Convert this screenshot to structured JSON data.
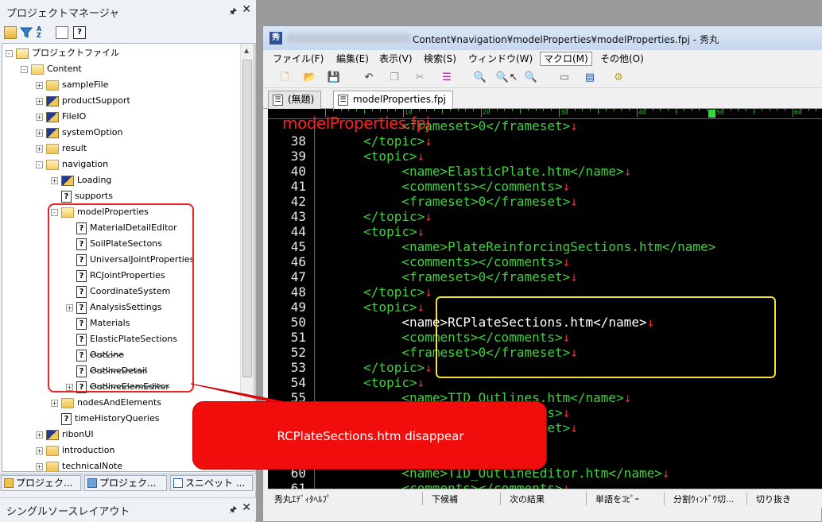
{
  "project_manager": {
    "title": "プロジェクトマネージャ",
    "pin": "ᵖ",
    "close": "✕",
    "toolbar_icons": [
      "folder-open-icon",
      "filter-icon",
      "sort-az-icon",
      "document-icon",
      "help-icon"
    ],
    "tree": [
      {
        "label": "プロジェクトファイル",
        "icon": "project",
        "level": 0,
        "expander": "-"
      },
      {
        "label": "Content",
        "icon": "folder-open",
        "level": 1,
        "expander": "-"
      },
      {
        "label": "sampleFile",
        "icon": "folder",
        "level": 2,
        "expander": "+"
      },
      {
        "label": "productSupport",
        "icon": "folder-mixed",
        "level": 2,
        "expander": "+"
      },
      {
        "label": "FileIO",
        "icon": "folder-mixed",
        "level": 2,
        "expander": "+"
      },
      {
        "label": "systemOption",
        "icon": "folder-mixed",
        "level": 2,
        "expander": "+"
      },
      {
        "label": "result",
        "icon": "folder",
        "level": 2,
        "expander": "+"
      },
      {
        "label": "navigation",
        "icon": "folder-open",
        "level": 2,
        "expander": "-"
      },
      {
        "label": "Loading",
        "icon": "folder-mixed",
        "level": 3,
        "expander": "+"
      },
      {
        "label": "supports",
        "icon": "help",
        "level": 3,
        "expander": ""
      },
      {
        "label": "modelProperties",
        "icon": "folder-open",
        "level": 3,
        "expander": "-"
      },
      {
        "label": "MaterialDetailEditor",
        "icon": "help",
        "level": 4,
        "expander": ""
      },
      {
        "label": "SoilPlateSectons",
        "icon": "help",
        "level": 4,
        "expander": ""
      },
      {
        "label": "UniversalJointProperties",
        "icon": "help",
        "level": 4,
        "expander": ""
      },
      {
        "label": "RCJointProperties",
        "icon": "help",
        "level": 4,
        "expander": ""
      },
      {
        "label": "CoordinateSystem",
        "icon": "help",
        "level": 4,
        "expander": ""
      },
      {
        "label": "AnalysisSettings",
        "icon": "help",
        "level": 4,
        "expander": "+"
      },
      {
        "label": "Materials",
        "icon": "help",
        "level": 4,
        "expander": ""
      },
      {
        "label": "ElasticPlateSections",
        "icon": "help",
        "level": 4,
        "expander": ""
      },
      {
        "label": "OutLine",
        "icon": "help",
        "level": 4,
        "expander": "",
        "struck": true
      },
      {
        "label": "OutlineDetail",
        "icon": "help",
        "level": 4,
        "expander": "",
        "struck": true
      },
      {
        "label": "OutlineElemEditor",
        "icon": "help",
        "level": 4,
        "expander": "+",
        "struck": true
      },
      {
        "label": "nodesAndElements",
        "icon": "folder",
        "level": 3,
        "expander": "+"
      },
      {
        "label": "timeHistoryQueries",
        "icon": "help",
        "level": 3,
        "expander": ""
      },
      {
        "label": "ribonUI",
        "icon": "folder-mixed",
        "level": 2,
        "expander": "+"
      },
      {
        "label": "introduction",
        "icon": "folder",
        "level": 2,
        "expander": "+"
      },
      {
        "label": "technicalNote",
        "icon": "folder",
        "level": 2,
        "expander": "+"
      }
    ],
    "bottom_tabs": [
      "プロジェク...",
      "プロジェク...",
      "スニペット ..."
    ],
    "single_source_layout_title": "シングルソースレイアウト"
  },
  "editor": {
    "title": "Content¥navigation¥modelProperties¥modelProperties.fpj  - 秀丸",
    "menu": [
      "ファイル(F)",
      "編集(E)",
      "表示(V)",
      "検索(S)",
      "ウィンドウ(W)",
      "マクロ(M)",
      "その他(O)"
    ],
    "active_menu": "マクロ(M)",
    "tabs": [
      "(無題)",
      "modelProperties.fpj"
    ],
    "overlay_title": "modelProperties.fpj",
    "ruler_labels": [
      "10",
      "20",
      "30",
      "40",
      "50",
      "60"
    ],
    "code_lines": [
      {
        "n": "",
        "text": "          <frameset>0</frameset>",
        "eol": "↓"
      },
      {
        "n": "38",
        "text": "     </topic>",
        "eol": "↓"
      },
      {
        "n": "39",
        "text": "     <topic>",
        "eol": "↓"
      },
      {
        "n": "40",
        "text": "          <name>ElasticPlate.htm</name>",
        "eol": "↓"
      },
      {
        "n": "41",
        "text": "          <comments></comments>",
        "eol": "↓"
      },
      {
        "n": "42",
        "text": "          <frameset>0</frameset>",
        "eol": "↓"
      },
      {
        "n": "43",
        "text": "     </topic>",
        "eol": "↓"
      },
      {
        "n": "44",
        "text": "     <topic>",
        "eol": "↓"
      },
      {
        "n": "45",
        "text": "          <name>PlateReinforcingSections.htm</name>",
        "eol": ""
      },
      {
        "n": "46",
        "text": "          <comments></comments>",
        "eol": "↓"
      },
      {
        "n": "47",
        "text": "          <frameset>0</frameset>",
        "eol": "↓"
      },
      {
        "n": "48",
        "text": "     </topic>",
        "eol": "↓"
      },
      {
        "n": "49",
        "text": "     <topic>",
        "eol": "↓"
      },
      {
        "n": "50",
        "text": "          <name>RCPlateSections.htm</name>",
        "eol": "↓",
        "highlight": true
      },
      {
        "n": "51",
        "text": "          <comments></comments>",
        "eol": "↓"
      },
      {
        "n": "52",
        "text": "          <frameset>0</frameset>",
        "eol": "↓"
      },
      {
        "n": "53",
        "text": "     </topic>",
        "eol": "↓"
      },
      {
        "n": "54",
        "text": "     <topic>",
        "eol": "↓"
      },
      {
        "n": "55",
        "text": "          <name>TID_Outlines.htm</name>",
        "eol": "↓"
      },
      {
        "n": "56",
        "text": "          <comments></comments>",
        "eol": "↓"
      },
      {
        "n": "57",
        "text": "          <frameset>0</frameset>",
        "eol": "↓"
      },
      {
        "n": "58",
        "text": "     </topic>",
        "eol": "↓"
      },
      {
        "n": "59",
        "text": "     <topic>",
        "eol": "↓"
      },
      {
        "n": "60",
        "text": "          <name>TID_OutlineEditor.htm</name>",
        "eol": "↓"
      },
      {
        "n": "61",
        "text": "          <comments></comments>",
        "eol": "↓"
      }
    ],
    "status": [
      "秀丸ｴﾃﾞｨﾀﾍﾙﾌﾟ",
      "下候補",
      "次の結果",
      "単語をｺﾋﾟｰ",
      "分割ｳｨﾝﾄﾞｳ切...",
      "切り抜き"
    ]
  },
  "callout": {
    "text": "RCPlateSections.htm disappear"
  },
  "colors": {
    "code_bg": "#000000",
    "code_fg": "#3fd23f",
    "line_number": "#e8e8e8",
    "eol_marker": "#e03232",
    "annotation_red": "#f20d0d",
    "highlight_box": "#f2e43a"
  }
}
